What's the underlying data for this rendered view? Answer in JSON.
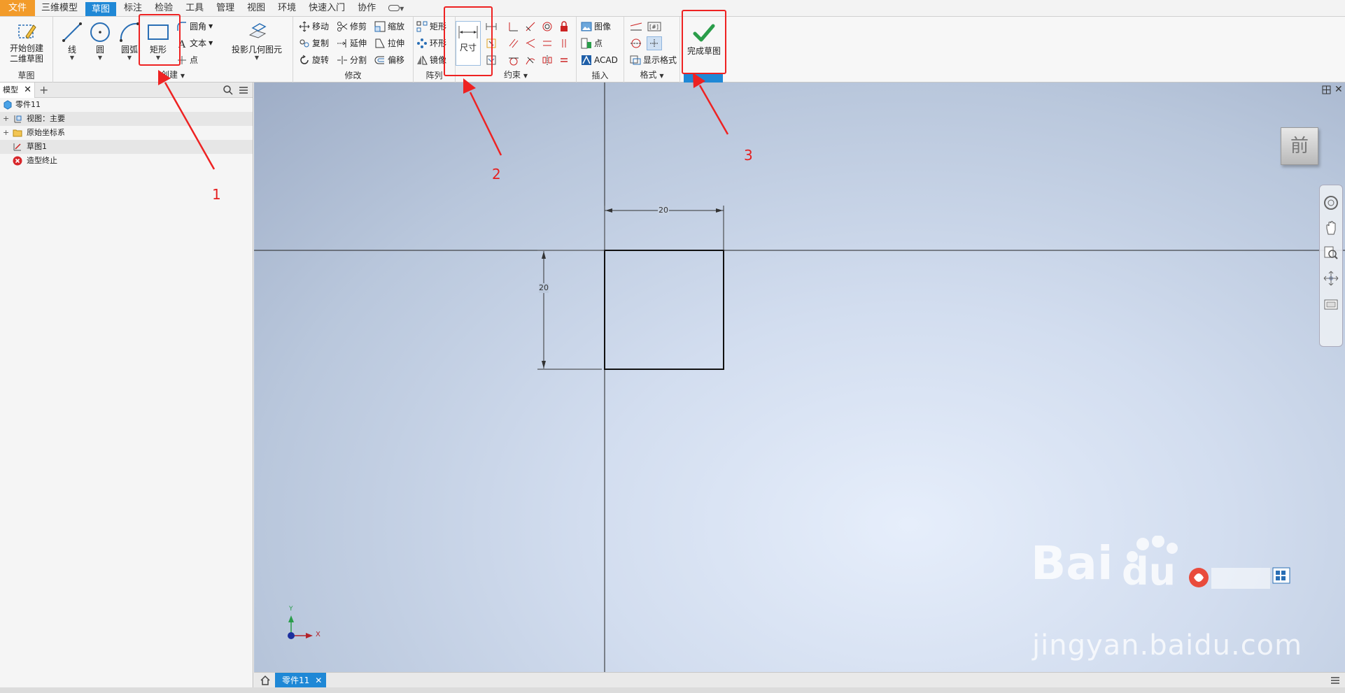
{
  "menu": {
    "tabs": [
      "文件",
      "三维模型",
      "草图",
      "标注",
      "检验",
      "工具",
      "管理",
      "视图",
      "环境",
      "快速入门",
      "协作"
    ],
    "active": "草图"
  },
  "ribbon": {
    "sketch_panel": {
      "start_2d": [
        "开始创建",
        "二维草图"
      ],
      "label": "草图"
    },
    "create_panel": {
      "line": "线",
      "circle": "圆",
      "arc": "圆弧",
      "rectangle": "矩形",
      "fillet": "圆角",
      "text": "文本",
      "point": "点",
      "project": "投影几何图元",
      "label": "创建"
    },
    "modify_panel": {
      "move": "移动",
      "trim": "修剪",
      "scale": "缩放",
      "copy": "复制",
      "extend": "延伸",
      "stretch": "拉伸",
      "rotate": "旋转",
      "split": "分割",
      "offset": "偏移",
      "label": "修改"
    },
    "pattern_panel": {
      "rect": "矩形",
      "circular": "环形",
      "mirror": "镜像",
      "label": "阵列"
    },
    "constrain_panel": {
      "dimension": "尺寸",
      "label": "约束"
    },
    "insert_panel": {
      "image": "图像",
      "point": "点",
      "acad": "ACAD",
      "label": "插入"
    },
    "format_panel": {
      "show_format": "显示格式",
      "label": "格式"
    },
    "exit_panel": {
      "finish": "完成草图"
    }
  },
  "browser": {
    "tab": "模型",
    "tree": [
      {
        "label": "零件11"
      },
      {
        "label": "视图：主要"
      },
      {
        "label": "原始坐标系"
      },
      {
        "label": "草图1"
      },
      {
        "label": "造型终止"
      }
    ]
  },
  "canvas": {
    "dim_horizontal": "20",
    "dim_vertical": "20",
    "viewcube": "前",
    "axis_x": "X",
    "axis_y": "Y"
  },
  "doc_tab": "零件11",
  "annotations": [
    "1",
    "2",
    "3"
  ],
  "watermark": {
    "text": "jingyan.baidu.com"
  },
  "colors": {
    "accent": "#1f88d6",
    "file_tab": "#f29b2a",
    "annotation": "#ee2222"
  }
}
